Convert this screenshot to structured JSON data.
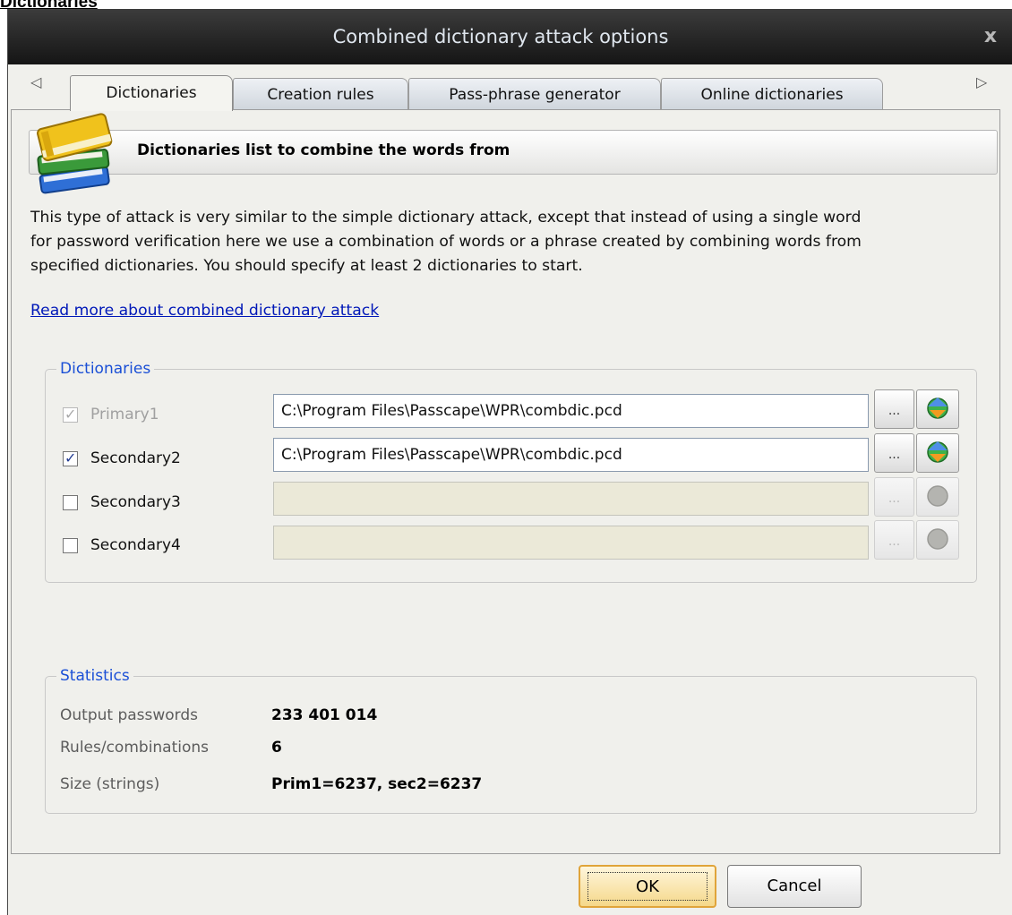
{
  "doc_heading": "Dictionaries",
  "window": {
    "title": "Combined dictionary attack options",
    "close_label": "x"
  },
  "tabs": [
    {
      "label": "Dictionaries",
      "active": true
    },
    {
      "label": "Creation rules",
      "active": false
    },
    {
      "label": "Pass-phrase generator",
      "active": false
    },
    {
      "label": "Online dictionaries",
      "active": false
    }
  ],
  "tab_scroll": {
    "left": "◁",
    "right": "▷"
  },
  "header": {
    "title": "Dictionaries list to combine the words from",
    "icon": "books-icon"
  },
  "description_lines": [
    "This type of attack is very similar to the simple dictionary attack, except that instead of using a single word",
    "for password verification here we use a combination of words or a phrase created by combining words from",
    "specified dictionaries. You should specify at least 2 dictionaries to start."
  ],
  "read_more_link": "Read more about combined dictionary attack",
  "dictionaries_group": {
    "label": "Dictionaries",
    "rows": [
      {
        "label": "Primary1",
        "checked": true,
        "enabled": false,
        "path": "C:\\Program Files\\Passcape\\WPR\\combdic.pcd",
        "browse": "...",
        "field_enabled": true
      },
      {
        "label": "Secondary2",
        "checked": true,
        "enabled": true,
        "path": "C:\\Program Files\\Passcape\\WPR\\combdic.pcd",
        "browse": "...",
        "field_enabled": true
      },
      {
        "label": "Secondary3",
        "checked": false,
        "enabled": true,
        "path": "",
        "browse": "...",
        "field_enabled": false
      },
      {
        "label": "Secondary4",
        "checked": false,
        "enabled": true,
        "path": "",
        "browse": "...",
        "field_enabled": false
      }
    ]
  },
  "statistics_group": {
    "label": "Statistics",
    "rows": [
      {
        "label": "Output passwords",
        "value": "233 401 014"
      },
      {
        "label": "Rules/combinations",
        "value": "6"
      },
      {
        "label": "Size (strings)",
        "value": "Prim1=6237, sec2=6237"
      }
    ]
  },
  "buttons": {
    "ok": "OK",
    "cancel": "Cancel"
  },
  "colors": {
    "accent_link": "#0018b8",
    "group_label": "#1a4fd6",
    "ok_border": "#e0a43a"
  }
}
